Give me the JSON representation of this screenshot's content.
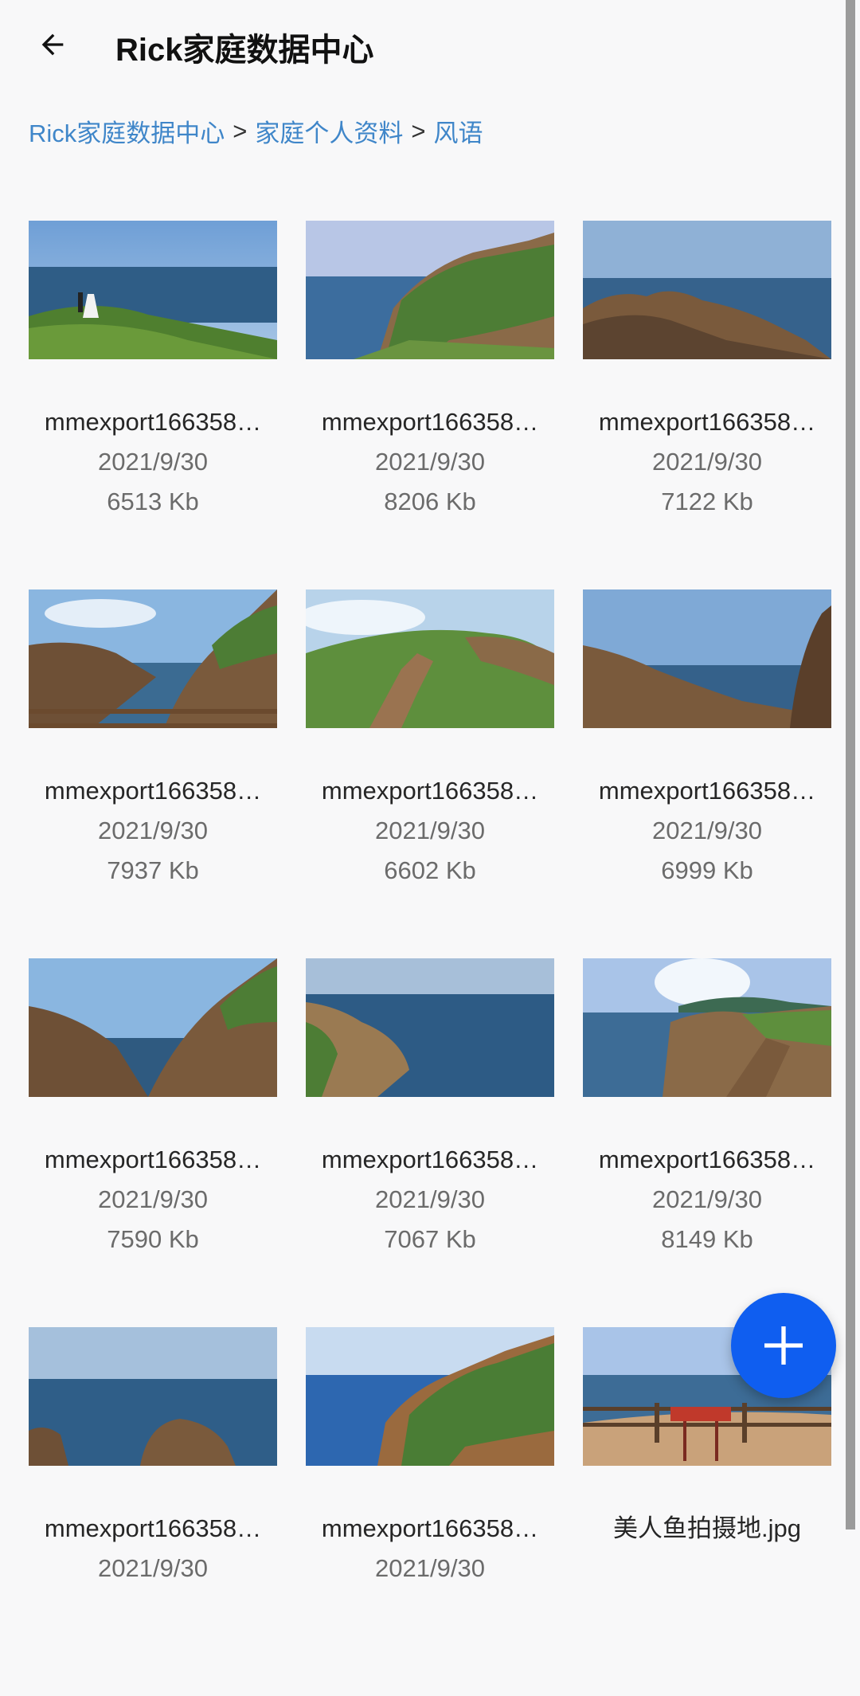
{
  "app_bar": {
    "title": "Rick家庭数据中心",
    "back_icon": "arrow-left-icon"
  },
  "breadcrumb": {
    "items": [
      "Rick家庭数据中心",
      "家庭个人资料",
      "风语"
    ],
    "separator": ">"
  },
  "files": [
    {
      "name": "mmexport166358…",
      "date": "2021/9/30",
      "size": "6513 Kb",
      "scene": "couple-cliff"
    },
    {
      "name": "mmexport166358…",
      "date": "2021/9/30",
      "size": "8206 Kb",
      "scene": "headland"
    },
    {
      "name": "mmexport166358…",
      "date": "2021/9/30",
      "size": "7122 Kb",
      "scene": "rocks-sea"
    },
    {
      "name": "mmexport166358…",
      "date": "2021/9/30",
      "size": "7937 Kb",
      "scene": "cove-rail"
    },
    {
      "name": "mmexport166358…",
      "date": "2021/9/30",
      "size": "6602 Kb",
      "scene": "stairs-hill"
    },
    {
      "name": "mmexport166358…",
      "date": "2021/9/30",
      "size": "6999 Kb",
      "scene": "rocks-right"
    },
    {
      "name": "mmexport166358…",
      "date": "2021/9/30",
      "size": "7590 Kb",
      "scene": "cove"
    },
    {
      "name": "mmexport166358…",
      "date": "2021/9/30",
      "size": "7067 Kb",
      "scene": "sea-left-rock"
    },
    {
      "name": "mmexport166358…",
      "date": "2021/9/30",
      "size": "8149 Kb",
      "scene": "coast-island"
    },
    {
      "name": "mmexport166358…",
      "date": "2021/9/30",
      "size": "",
      "scene": "sea-rocks-low"
    },
    {
      "name": "mmexport166358…",
      "date": "2021/9/30",
      "size": "",
      "scene": "headland-blue"
    },
    {
      "name": "美人鱼拍摄地.jpg",
      "date": "",
      "size": "",
      "scene": "viewpoint-sign"
    }
  ],
  "fab": {
    "icon": "plus-icon"
  },
  "colors": {
    "accent": "#0f5ef0",
    "link": "#3f86c9",
    "background": "#f8f8f9"
  }
}
